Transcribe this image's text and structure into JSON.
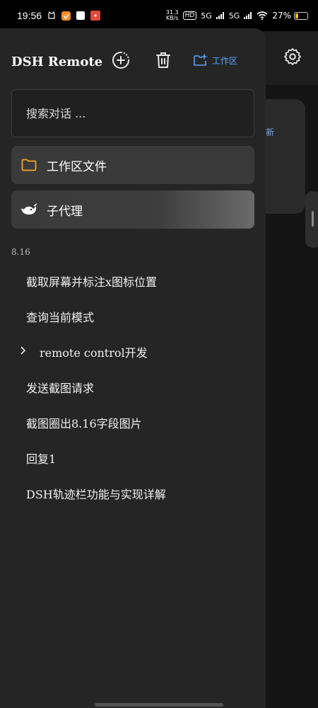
{
  "status_bar": {
    "time": "19:56",
    "net_speed_value": "31.3",
    "net_speed_unit": "KB/s",
    "hd_label": "HD",
    "signal1": "5G",
    "signal2": "5G",
    "battery_percent": "27%",
    "battery_level": 0.27
  },
  "drawer": {
    "title": "DSH Remote",
    "new_chat_icon": "plus-circle-icon",
    "delete_icon": "trash-icon",
    "workspace_label": "工作区",
    "search_placeholder": "搜索对话 ...",
    "workspace_files_label": "工作区文件",
    "subagent_label": "子代理",
    "section_date": "8.16",
    "conversations": [
      {
        "title": "截取屏幕并标注x图标位置"
      },
      {
        "title": "查询当前模式"
      },
      {
        "title": "remote control开发",
        "expandable": true
      },
      {
        "title": "发送截图请求"
      },
      {
        "title": "截图圈出8.16字段图片"
      },
      {
        "title": "回复1"
      },
      {
        "title": "DSH轨迹栏功能与实现详解"
      }
    ]
  },
  "background": {
    "settings_icon": "gear-icon",
    "card_partial_text": "新"
  },
  "colors": {
    "accent_blue": "#5ba3f5",
    "folder_orange": "#f5a623",
    "drawer_bg": "#252525"
  }
}
